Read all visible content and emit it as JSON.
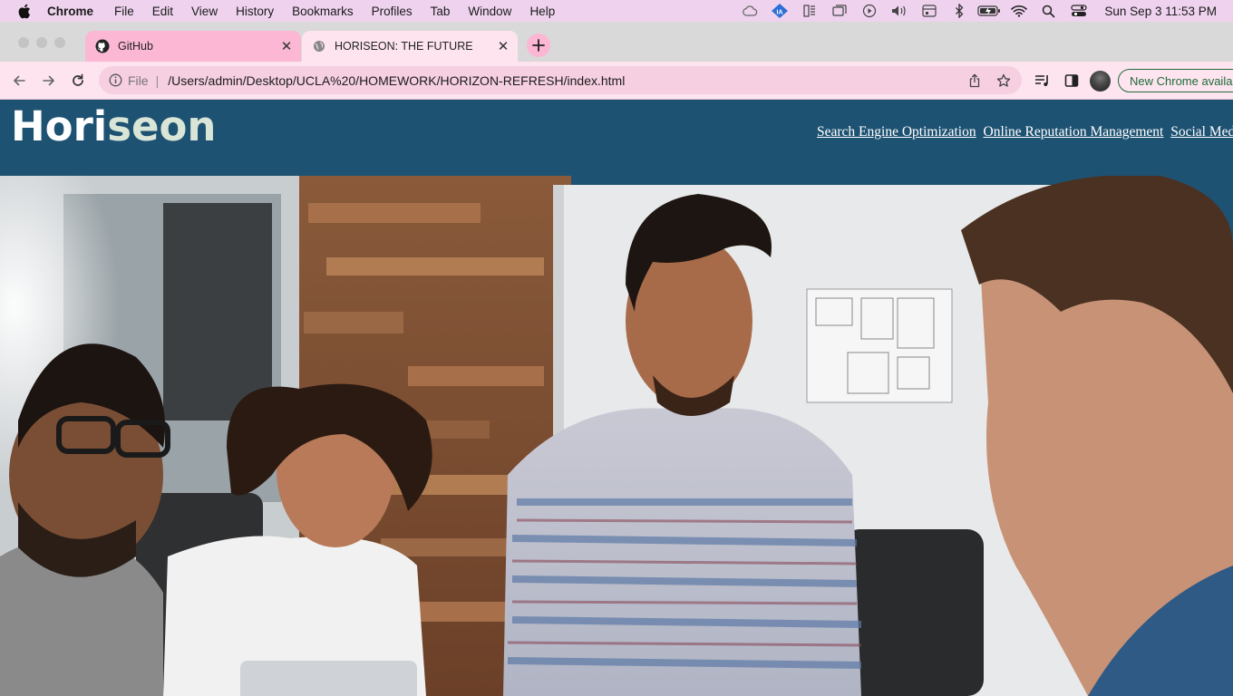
{
  "menubar": {
    "app_name": "Chrome",
    "items": [
      "File",
      "Edit",
      "View",
      "History",
      "Bookmarks",
      "Profiles",
      "Tab",
      "Window",
      "Help"
    ],
    "clock": "Sun Sep 3  11:53 PM"
  },
  "tabs": [
    {
      "title": "GitHub",
      "icon": "github-icon"
    },
    {
      "title": "HORISEON: THE FUTURE",
      "icon": "globe-icon"
    }
  ],
  "address_bar": {
    "scheme": "File",
    "url": "/Users/admin/Desktop/UCLA%20/HOMEWORK/HORIZON-REFRESH/index.html"
  },
  "update_button": "New Chrome available",
  "site": {
    "logo_part1": "Hori",
    "logo_part2": "seon",
    "nav": [
      "Search Engine Optimization",
      "Online Reputation Management",
      "Social Media Marketing"
    ]
  },
  "colors": {
    "header_bg": "#1e5272",
    "logo_accent": "#d9e5d6",
    "menubar_bg": "#efd3ee",
    "tab_active": "#fde4ef",
    "tab_inactive": "#fbb7d3"
  }
}
